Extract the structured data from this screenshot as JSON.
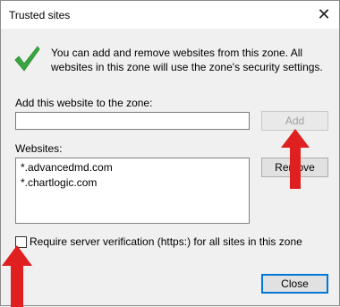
{
  "dialog": {
    "title": "Trusted sites",
    "info_text": "You can add and remove websites from this zone. All websites in this zone will use the zone's security settings.",
    "add_label": "Add this website to the zone:",
    "url_input_value": "",
    "add_button": "Add",
    "websites_label": "Websites:",
    "websites": [
      "*.advancedmd.com",
      "*.chartlogic.com"
    ],
    "remove_button": "Remove",
    "require_https_label": "Require server verification (https:) for all sites in this zone",
    "require_https_checked": false,
    "close_button": "Close"
  },
  "colors": {
    "accent": "#0078d7",
    "check": "#3aa640",
    "arrow": "#e02020"
  }
}
